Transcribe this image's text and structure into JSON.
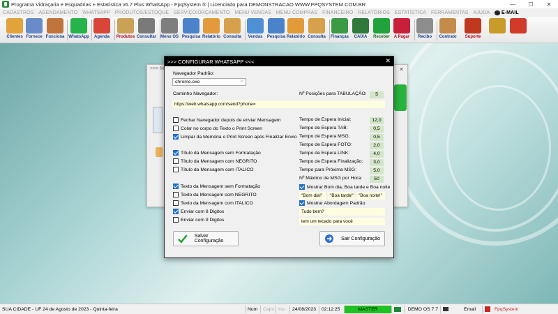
{
  "window": {
    "title": "Programa Vidraçaria e Esquadrias + Estatística v6.7 Plus WhatsApp - FpqSystem ® | Licenciado para  DEMONSTRACAO WWW.FPQSYSTEM.COM.BR",
    "minimize": "—",
    "maximize": "☐",
    "close": "✕"
  },
  "menu": {
    "items": [
      "CADASTROS",
      "AGENDAMENTO",
      "WHATSAPP",
      "PRODUTOS/ESTOQUE",
      "SERVIÇO/ORÇAMENTO",
      "MENU VENDAS",
      "MENU COMPRAS",
      "FINANCEIRO",
      "RELATÓRIOS",
      "ESTATÍSTICA",
      "FERRAMENTAS",
      "AJUDA"
    ],
    "email": "E-MAIL"
  },
  "toolbar": {
    "buttons": [
      {
        "label": "Clientes",
        "color": "#e3a33b",
        "style": "blue"
      },
      {
        "label": "Fornece",
        "color": "#6a8bc9",
        "style": "blue"
      },
      {
        "label": "Funciona",
        "color": "#c0733b",
        "style": "blue"
      },
      {
        "label": "WhatsApp",
        "color": "#25b34a",
        "style": "blue"
      },
      {
        "label": "Agenda",
        "color": "#d8463a",
        "style": "blue"
      },
      {
        "label": "Produtos",
        "color": "#caa157",
        "style": "red"
      },
      {
        "label": "Consultar",
        "color": "#7a7a7a",
        "style": "blue"
      },
      {
        "label": "Menu OS",
        "color": "#7e7e7e",
        "style": "blue"
      },
      {
        "label": "Pesquisa",
        "color": "#4a83c9",
        "style": "blue"
      },
      {
        "label": "Relatório",
        "color": "#e29a3a",
        "style": "blue"
      },
      {
        "label": "Consulta",
        "color": "#d6a14a",
        "style": "blue"
      },
      {
        "label": "Vendas",
        "color": "#4f8fd4",
        "style": "blue"
      },
      {
        "label": "Pesquisa",
        "color": "#4a83c9",
        "style": "blue"
      },
      {
        "label": "Relatório",
        "color": "#e29a3a",
        "style": "blue"
      },
      {
        "label": "Consulta",
        "color": "#d6a14a",
        "style": "blue"
      },
      {
        "label": "Finanças",
        "color": "#3a9b44",
        "style": "blue"
      },
      {
        "label": "CAIXA",
        "color": "#2f7a3a",
        "style": "blue"
      },
      {
        "label": "Receber",
        "color": "#1fa33a",
        "style": "green"
      },
      {
        "label": "A Pagar",
        "color": "#c8203a",
        "style": "red"
      },
      {
        "label": "Recibo",
        "color": "#8d8d8d",
        "style": "blue"
      },
      {
        "label": "Contrato",
        "color": "#c58b4a",
        "style": "blue"
      },
      {
        "label": "Suporte",
        "color": "#c0391e",
        "style": "red"
      },
      {
        "label": "",
        "color": "#c99b2a",
        "style": "blue"
      },
      {
        "label": "",
        "color": "#d03b2a",
        "style": "blue"
      }
    ]
  },
  "background_window": {
    "title": ">>> M",
    "close": "✕"
  },
  "dialog": {
    "title": ">>> CONFIGURAR WHATSAPP <<<",
    "close": "✕",
    "browser_label": "Navegador Padrão:",
    "browser_value": "chrome.exe",
    "path_label": "Caminho Navegador:",
    "path_value": "https://web.whatsapp.com/send?phone=",
    "tab_positions_label": "Nº Posições para TABULAÇÃO:",
    "tab_positions_value": "5",
    "checks_a": [
      {
        "label": "Fechar Navegador depois de enviar Mensagem",
        "checked": false
      },
      {
        "label": "Colar no corpo do Texto o Print Screen",
        "checked": false
      },
      {
        "label": "Limpar da Memória o Print Screen após Finalizar Envio",
        "checked": true
      }
    ],
    "checks_b": [
      {
        "label": "Título da Mensagem sem Formatação",
        "checked": true
      },
      {
        "label": "Título da Mensagem com NEGRITO",
        "checked": false
      },
      {
        "label": "Título da Mensagem com ITALICO",
        "checked": false
      }
    ],
    "checks_c": [
      {
        "label": "Texto da Mensagem sem Formatação",
        "checked": true
      },
      {
        "label": "Texto da Mensagem com NEGRITO",
        "checked": false
      },
      {
        "label": "Texto da Mensagem com ITALICO",
        "checked": false
      },
      {
        "label": "Enviar com 8 Digitos",
        "checked": true
      },
      {
        "label": "Enviar com 9 Digitos",
        "checked": false
      }
    ],
    "timings": [
      {
        "label": "Tempo de Espera Inicial:",
        "value": "12,0"
      },
      {
        "label": "Tempo de Espera TAB:",
        "value": "0,5"
      },
      {
        "label": "Tempo de Espera MSG:",
        "value": "0,5"
      },
      {
        "label": "Tempo de Espera FOTO:",
        "value": "2,0"
      },
      {
        "label": "Tempo de Espera LINK:",
        "value": "4,0"
      },
      {
        "label": "Tempo de Espera Finalização:",
        "value": "3,0"
      },
      {
        "label": "Tempo para Próxima MSG:",
        "value": "5,0"
      },
      {
        "label": "Nº Máximo de MSG por Hora:",
        "value": "50"
      }
    ],
    "greeting_check": {
      "label": "Mostrar Bom dia, Boa tarde e Boa noite",
      "checked": true
    },
    "greetings": [
      "\"Bom dia!\"",
      "\"Boa tarde!\"",
      "\"Boa noite!\""
    ],
    "approach_check": {
      "label": "Mostrar Abordagem Padrão",
      "checked": true
    },
    "approach_1": "Tudo bem?",
    "approach_2": "tem um recado para você",
    "save_label": "Salvar Configuração",
    "exit_label": "Sair Configuração"
  },
  "status": {
    "city": "SUA CIDADE - UF 24 de Agosto de 2023 - Quinta-feira",
    "num": "Num",
    "caps": "Caps",
    "ins": "Ins",
    "date": "24/08/2023",
    "time": "02:12:25",
    "master": "MASTER",
    "demo": "DEMO OS 7.7",
    "email": "Email",
    "brand": "FpqSystem"
  }
}
